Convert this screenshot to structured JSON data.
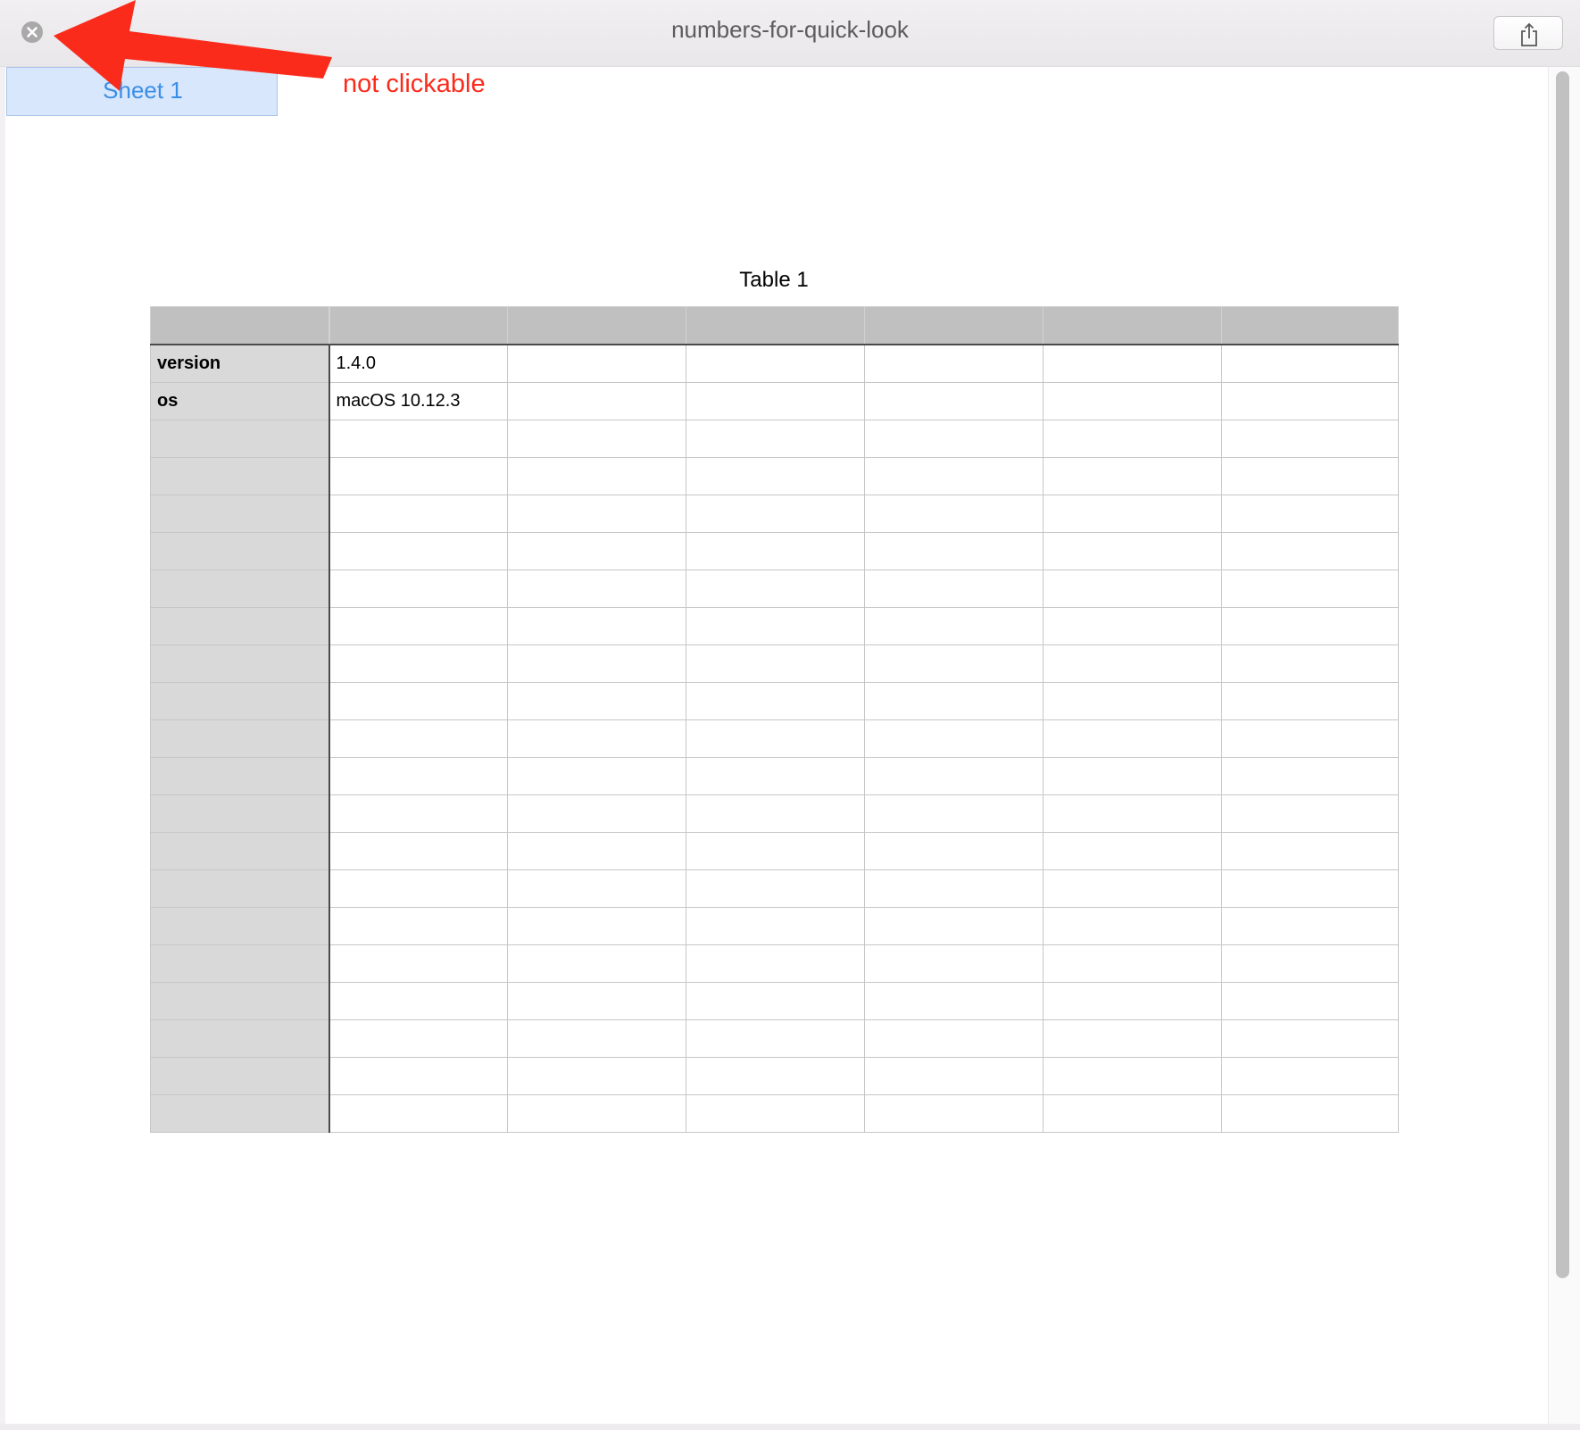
{
  "window": {
    "title": "numbers-for-quick-look"
  },
  "icons": {
    "close": "close-icon",
    "share": "share-icon",
    "arrow": "red-arrow-annotation"
  },
  "sheet_tab": {
    "label": "Sheet 1"
  },
  "annotation": {
    "text": "not clickable",
    "color": "#fb2b1c"
  },
  "table": {
    "title": "Table 1",
    "columns": 7,
    "rows": [
      [
        "version",
        "1.4.0",
        "",
        "",
        "",
        "",
        ""
      ],
      [
        "os",
        "macOS 10.12.3",
        "",
        "",
        "",
        "",
        ""
      ],
      [
        "",
        "",
        "",
        "",
        "",
        "",
        ""
      ],
      [
        "",
        "",
        "",
        "",
        "",
        "",
        ""
      ],
      [
        "",
        "",
        "",
        "",
        "",
        "",
        ""
      ],
      [
        "",
        "",
        "",
        "",
        "",
        "",
        ""
      ],
      [
        "",
        "",
        "",
        "",
        "",
        "",
        ""
      ],
      [
        "",
        "",
        "",
        "",
        "",
        "",
        ""
      ],
      [
        "",
        "",
        "",
        "",
        "",
        "",
        ""
      ],
      [
        "",
        "",
        "",
        "",
        "",
        "",
        ""
      ],
      [
        "",
        "",
        "",
        "",
        "",
        "",
        ""
      ],
      [
        "",
        "",
        "",
        "",
        "",
        "",
        ""
      ],
      [
        "",
        "",
        "",
        "",
        "",
        "",
        ""
      ],
      [
        "",
        "",
        "",
        "",
        "",
        "",
        ""
      ],
      [
        "",
        "",
        "",
        "",
        "",
        "",
        ""
      ],
      [
        "",
        "",
        "",
        "",
        "",
        "",
        ""
      ],
      [
        "",
        "",
        "",
        "",
        "",
        "",
        ""
      ],
      [
        "",
        "",
        "",
        "",
        "",
        "",
        ""
      ],
      [
        "",
        "",
        "",
        "",
        "",
        "",
        ""
      ],
      [
        "",
        "",
        "",
        "",
        "",
        "",
        ""
      ],
      [
        "",
        "",
        "",
        "",
        "",
        "",
        ""
      ]
    ]
  },
  "colors": {
    "tab_background": "#d8e7fb",
    "tab_text": "#3b8ee8",
    "header_fill": "#bfc0bf",
    "row_header_fill": "#d9d9d9"
  }
}
